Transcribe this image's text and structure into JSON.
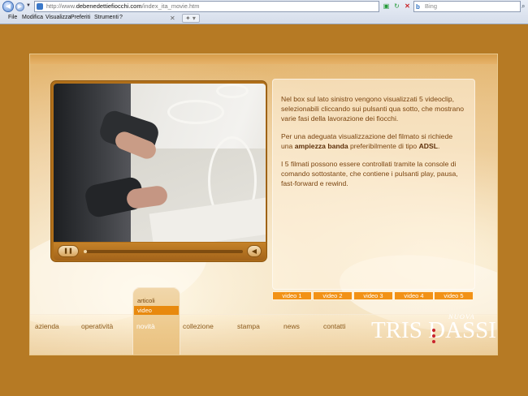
{
  "browser": {
    "address_prefix": "http://www.",
    "address_host": "debenedettiefiocchi.com",
    "address_path": "/index_ita_movie.htm",
    "search_placeholder": "Bing",
    "menu": [
      "File",
      "Modifica",
      "Visualizza",
      "Preferiti",
      "Strumenti",
      "?"
    ]
  },
  "info": {
    "p1": "Nel box sul lato sinistro vengono visualizzati 5 videoclip, selezionabili cliccando sui pulsanti qua sotto, che mostrano varie fasi della lavorazione dei fiocchi.",
    "p2_a": "Per una adeguata visualizzazione del filmato si richiede una ",
    "p2_b1": "ampiezza banda",
    "p2_c": " preferibilmente di tipo ",
    "p2_b2": "ADSL",
    "p2_d": ".",
    "p3": "I 5 filmati possono essere controllati tramite la console di comando sottostante, che contiene i pulsanti play, pausa, fast-forward e rewind."
  },
  "player": {
    "progress_fraction": 0.02
  },
  "clips": [
    "video 1",
    "video 2",
    "video 3",
    "video 4",
    "video 5"
  ],
  "nav": [
    "azienda",
    "operatività",
    "novità",
    "collezione",
    "stampa",
    "news",
    "contatti"
  ],
  "submenu": [
    "articoli",
    "video"
  ],
  "logo": {
    "small": "NUOVA",
    "main": "TRIS DASSI"
  },
  "colors": {
    "page_bg": "#b67a24",
    "accent_orange": "#f29216",
    "text_brown": "#7a4410"
  }
}
